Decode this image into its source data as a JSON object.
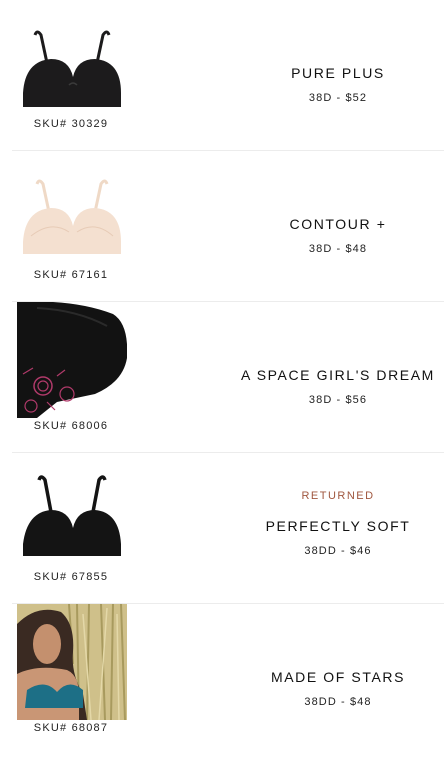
{
  "items": [
    {
      "sku": "SKU# 30329",
      "name": "PURE PLUS",
      "price": "38D - $52",
      "status": "",
      "color": "#1c1b1c",
      "image": "bra-black-icon"
    },
    {
      "sku": "SKU# 67161",
      "name": "CONTOUR +",
      "price": "38D - $48",
      "status": "",
      "color": "#f4e0d0",
      "image": "bra-nude-icon"
    },
    {
      "sku": "SKU# 68006",
      "name": "A SPACE GIRL'S DREAM",
      "price": "38D - $56",
      "status": "",
      "color": "#111111",
      "image": "bra-black-embroidered-closeup"
    },
    {
      "sku": "SKU# 67855",
      "name": "PERFECTLY SOFT",
      "price": "38DD - $46",
      "status": "RETURNED",
      "color": "#141414",
      "image": "bra-black-icon"
    },
    {
      "sku": "SKU# 68087",
      "name": "MADE OF STARS",
      "price": "38DD - $48",
      "status": "",
      "color": "#1d6f86",
      "image": "model-teal-bra-photo"
    }
  ],
  "colors": {
    "status": "#a0573f",
    "divider": "#ececec"
  }
}
